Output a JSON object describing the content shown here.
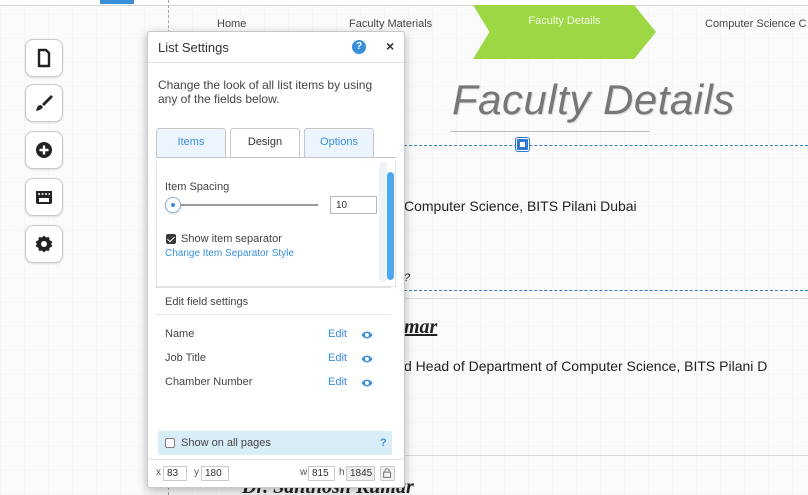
{
  "nav": {
    "items": [
      "Home",
      "Faculty Materials",
      "Faculty Details",
      "Computer Science C"
    ]
  },
  "page": {
    "hero_title": "Faculty Details",
    "line1": "Computer Science, BITS Pilani Dubai",
    "partial_q": "?",
    "heading1": "mar",
    "line2": "d Head of Department of Computer Science, BITS Pilani D",
    "heading2": "Dr. Santhosh Kumar"
  },
  "toolbar": {
    "buttons": [
      "page-icon",
      "brush-icon",
      "add-icon",
      "store-icon",
      "settings-icon"
    ]
  },
  "panel": {
    "title": "List Settings",
    "help": "?",
    "close": "×",
    "description": "Change the look of all list items by using any of the fields below.",
    "tabs": [
      "Items",
      "Design",
      "Options"
    ],
    "active_tab": "Design",
    "item_spacing_label": "Item Spacing",
    "item_spacing_value": "10",
    "show_separator_label": "Show item separator",
    "show_separator_checked": true,
    "change_separator_link": "Change Item Separator Style",
    "edit_fields_label": "Edit field settings",
    "fields": [
      {
        "name": "Name",
        "edit": "Edit"
      },
      {
        "name": "Job Title",
        "edit": "Edit"
      },
      {
        "name": "Chamber Number",
        "edit": "Edit"
      }
    ],
    "show_all_label": "Show on all pages",
    "show_all_checked": false,
    "show_all_help": "?",
    "x_label": "x",
    "x_value": "83",
    "y_label": "y",
    "y_value": "180",
    "w_label": "w",
    "w_value": "815",
    "h_label": "h",
    "h_value": "1845"
  },
  "colors": {
    "accent": "#3a8fd9",
    "nav_active": "#9ed744"
  }
}
